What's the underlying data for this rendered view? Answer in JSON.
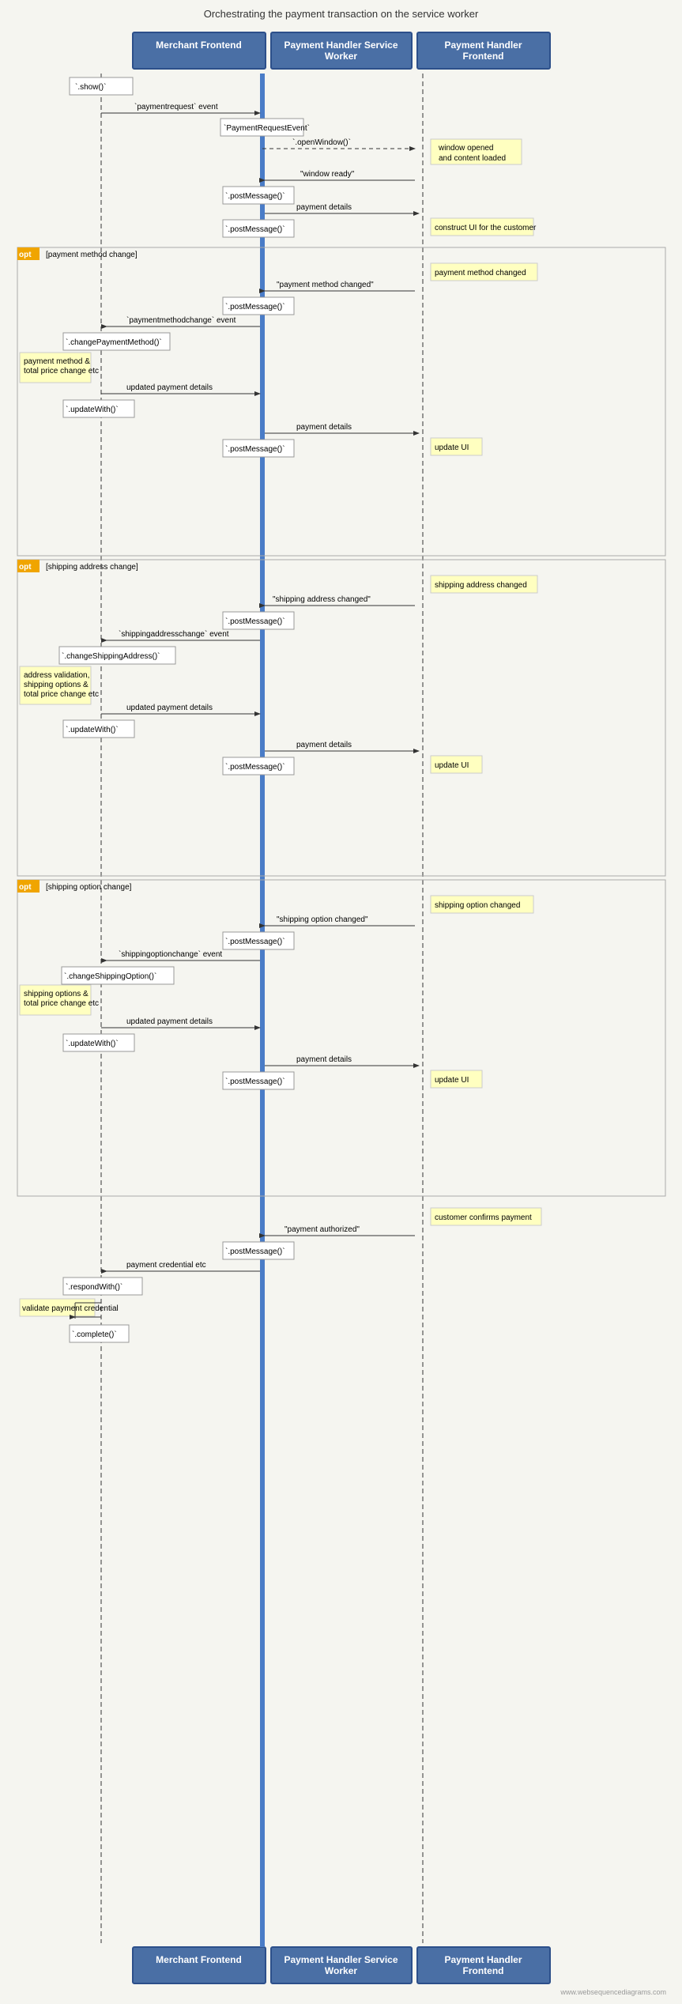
{
  "title": "Orchestrating the payment transaction on the service worker",
  "headers": {
    "merchant": "Merchant Frontend",
    "worker": "Payment Handler Service Worker",
    "frontend": "Payment Handler Frontend"
  },
  "footer": {
    "merchant": "Merchant Frontend",
    "worker": "Payment Handler Service Worker",
    "frontend": "Payment Handler Frontend"
  },
  "watermark": "www.websequencediagrams.com",
  "colors": {
    "header_bg": "#4a6fa5",
    "header_border": "#2c4f8a",
    "lifeline_worker": "#4a7cc7",
    "note_bg": "#ffffc0",
    "opt_bg": "#f0a500",
    "method_bg": "#ffffff"
  }
}
